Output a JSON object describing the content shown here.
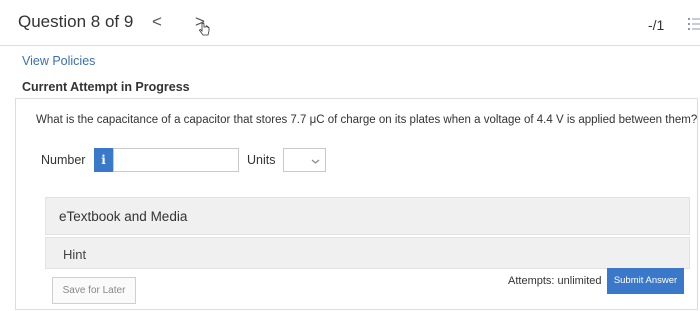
{
  "header": {
    "question_label": "Question 8 of 9",
    "prev_icon": "<",
    "next_icon": ">",
    "score": "-/1"
  },
  "links": {
    "view_policies": "View Policies"
  },
  "attempt": {
    "status_title": "Current Attempt in Progress"
  },
  "question": {
    "text": "What is the capacitance of a capacitor that stores 7.7 μC of charge on its plates when a voltage of 4.4 V is applied between them?"
  },
  "answer": {
    "number_label": "Number",
    "info_icon": "i",
    "number_value": "",
    "units_label": "Units",
    "units_value": ""
  },
  "resources": {
    "etextbook_label": "eTextbook and Media",
    "hint_label": "Hint"
  },
  "footer": {
    "save_later": "Save for Later",
    "attempts": "Attempts: unlimited",
    "submit": "Submit Answer"
  },
  "colors": {
    "accent": "#3a78c9",
    "link": "#3a6fb0"
  }
}
